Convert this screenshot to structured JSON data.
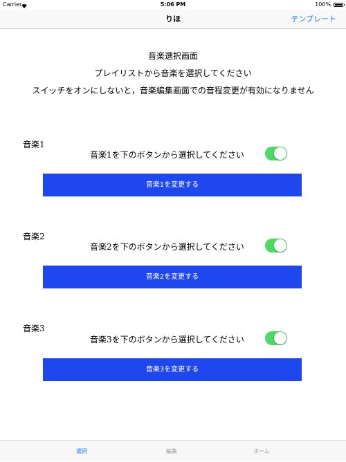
{
  "status_bar": {
    "carrier": "Carrier",
    "time": "5:06 PM",
    "battery": "100%",
    "battery_level": 1.0
  },
  "nav": {
    "title": "りほ",
    "right_button": "テンプレート"
  },
  "headings": {
    "title": "音楽選択画面",
    "line2": "プレイリストから音楽を選択してください",
    "line3": "スイッチをオンにしないと，音楽編集画面での音程変更が有効になりません"
  },
  "music": [
    {
      "label": "音楽1",
      "instruction": "音楽1を下のボタンから選択してください",
      "switch_on": true,
      "button": "音楽1を変更する"
    },
    {
      "label": "音楽2",
      "instruction": "音楽2を下のボタンから選択してください",
      "switch_on": true,
      "button": "音楽2を変更する"
    },
    {
      "label": "音楽3",
      "instruction": "音楽3を下のボタンから選択してください",
      "switch_on": true,
      "button": "音楽3を変更する"
    }
  ],
  "tabs": [
    {
      "label": "選択",
      "active": true
    },
    {
      "label": "編集",
      "active": false
    },
    {
      "label": "ホーム",
      "active": false
    }
  ],
  "colors": {
    "accent": "#1e7bf2",
    "button_bg": "#1e47ef",
    "switch_on": "#4cd964"
  }
}
